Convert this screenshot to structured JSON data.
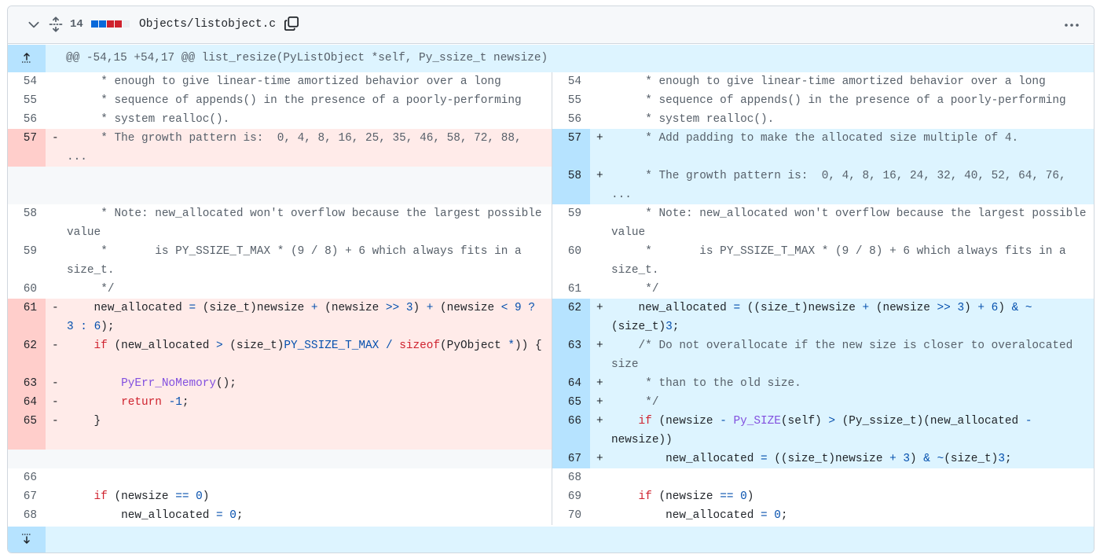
{
  "file": {
    "changes": "14",
    "diffstat": [
      "#0969da",
      "#0969da",
      "#cf222e",
      "#cf222e",
      "#eaeef2"
    ],
    "name": "Objects/listobject.c"
  },
  "hunk": {
    "header": "@@ -54,15 +54,17 @@ list_resize(PyListObject *self, Py_ssize_t newsize)"
  },
  "colors": {
    "deletion": "#ffebe9",
    "addition": "#ddf4ff",
    "keyword": "#cf222e",
    "function": "#8250df"
  },
  "icons": [
    "chevron-down-icon",
    "unfold-icon",
    "copy-icon",
    "kebab-horizontal-icon",
    "expand-up-icon",
    "expand-down-icon"
  ],
  "rows": [
    {
      "h": 24,
      "l": {
        "n": "54",
        "t": "ctx",
        "html": "<span class=\"cm\">     * enough to give linear-time amortized behavior over a long</span>"
      },
      "r": {
        "n": "54",
        "t": "ctx",
        "html": "<span class=\"cm\">     * enough to give linear-time amortized behavior over a long</span>"
      }
    },
    {
      "h": 24,
      "l": {
        "n": "55",
        "t": "ctx",
        "html": "<span class=\"cm\">     * sequence of appends() in the presence of a poorly-performing</span>"
      },
      "r": {
        "n": "55",
        "t": "ctx",
        "html": "<span class=\"cm\">     * sequence of appends() in the presence of a poorly-performing</span>"
      }
    },
    {
      "h": 24,
      "l": {
        "n": "56",
        "t": "ctx",
        "html": "<span class=\"cm\">     * system realloc().</span>"
      },
      "r": {
        "n": "56",
        "t": "ctx",
        "html": "<span class=\"cm\">     * system realloc().</span>"
      }
    },
    {
      "h": 48,
      "l": {
        "n": "57",
        "t": "del",
        "html": "<span class=\"cm\">     * The growth pattern is:  0, 4, 8, 16, 25, 35, 46, 58, 72, 88, ...</span>"
      },
      "r": {
        "n": "57",
        "t": "add",
        "html": "<span class=\"cm\">     * Add padding to make the allocated size multiple of 4.</span>"
      }
    },
    {
      "h": 48,
      "l": {
        "n": "",
        "t": "empty",
        "html": ""
      },
      "r": {
        "n": "58",
        "t": "add",
        "html": "<span class=\"cm\">     * The growth pattern is:  0, 4, 8, 16, 24, 32, 40, 52, 64, 76, ...</span>"
      }
    },
    {
      "h": 48,
      "l": {
        "n": "58",
        "t": "ctx",
        "html": "<span class=\"cm\">     * Note: new_allocated won't overflow because the largest possible value</span>"
      },
      "r": {
        "n": "59",
        "t": "ctx",
        "html": "<span class=\"cm\">     * Note: new_allocated won't overflow because the largest possible value</span>"
      }
    },
    {
      "h": 48,
      "l": {
        "n": "59",
        "t": "ctx",
        "html": "<span class=\"cm\">     *       is PY_SSIZE_T_MAX * (9 / 8) + 6 which always fits in a size_t.</span>"
      },
      "r": {
        "n": "60",
        "t": "ctx",
        "html": "<span class=\"cm\">     *       is PY_SSIZE_T_MAX * (9 / 8) + 6 which always fits in a size_t.</span>"
      }
    },
    {
      "h": 24,
      "l": {
        "n": "60",
        "t": "ctx",
        "html": "<span class=\"cm\">     */</span>"
      },
      "r": {
        "n": "61",
        "t": "ctx",
        "html": "<span class=\"cm\">     */</span>"
      }
    },
    {
      "h": 48,
      "l": {
        "n": "61",
        "t": "del",
        "html": "    new_allocated <span class=\"op\">=</span> (size_t)newsize <span class=\"op\">+</span> (newsize <span class=\"op\">&gt;&gt;</span> <span class=\"num\">3</span>) <span class=\"op\">+</span> (newsize <span class=\"op\">&lt;</span> <span class=\"num\">9</span> <span class=\"op\">?</span> <span class=\"num\">3</span> <span class=\"op\">:</span> <span class=\"num\">6</span>);"
      },
      "r": {
        "n": "62",
        "t": "add",
        "html": "    new_allocated <span class=\"op\">=</span> ((size_t)newsize <span class=\"op\">+</span> (newsize <span class=\"op\">&gt;&gt;</span> <span class=\"num\">3</span>) <span class=\"op\">+</span> <span class=\"num\">6</span>) <span class=\"op\">&amp;</span> <span class=\"op\">~</span>(size_t)<span class=\"num\">3</span>;"
      }
    },
    {
      "h": 48,
      "l": {
        "n": "62",
        "t": "del",
        "html": "    <span class=\"kw\">if</span> (new_allocated <span class=\"op\">&gt;</span> (size_t)<span class=\"ct\">PY_SSIZE_T_MAX</span> <span class=\"op\">/</span> <span class=\"kw\">sizeof</span>(PyObject <span class=\"op\">*</span>)) {"
      },
      "r": {
        "n": "63",
        "t": "add",
        "html": "<span class=\"cm\">    /* Do not overallocate if the new size is closer to overalocated size</span>"
      }
    },
    {
      "h": 24,
      "l": {
        "n": "63",
        "t": "del",
        "html": "        <span class=\"fn\">PyErr_NoMemory</span>();"
      },
      "r": {
        "n": "64",
        "t": "add",
        "html": "<span class=\"cm\">     * than to the old size.</span>"
      }
    },
    {
      "h": 24,
      "l": {
        "n": "64",
        "t": "del",
        "html": "        <span class=\"kw\">return</span> <span class=\"op\">-</span><span class=\"num\">1</span>;"
      },
      "r": {
        "n": "65",
        "t": "add",
        "html": "<span class=\"cm\">     */</span>"
      }
    },
    {
      "h": 48,
      "l": {
        "n": "65",
        "t": "del",
        "html": "    }"
      },
      "r": {
        "n": "66",
        "t": "add",
        "html": "    <span class=\"kw\">if</span> (newsize <span class=\"op\">-</span> <span class=\"fn\">Py_SIZE</span>(self) <span class=\"op\">&gt;</span> (Py_ssize_t)(new_allocated <span class=\"op\">-</span> newsize))"
      }
    },
    {
      "h": 24,
      "l": {
        "n": "",
        "t": "empty",
        "html": ""
      },
      "r": {
        "n": "67",
        "t": "add",
        "html": "        new_allocated <span class=\"op\">=</span> ((size_t)newsize <span class=\"op\">+</span> <span class=\"num\">3</span>) <span class=\"op\">&amp;</span> <span class=\"op\">~</span>(size_t)<span class=\"num\">3</span>;"
      }
    },
    {
      "h": 24,
      "l": {
        "n": "66",
        "t": "ctx",
        "html": ""
      },
      "r": {
        "n": "68",
        "t": "ctx",
        "html": ""
      }
    },
    {
      "h": 24,
      "l": {
        "n": "67",
        "t": "ctx",
        "html": "    <span class=\"kw\">if</span> (newsize <span class=\"op\">==</span> <span class=\"num\">0</span>)"
      },
      "r": {
        "n": "69",
        "t": "ctx",
        "html": "    <span class=\"kw\">if</span> (newsize <span class=\"op\">==</span> <span class=\"num\">0</span>)"
      }
    },
    {
      "h": 24,
      "l": {
        "n": "68",
        "t": "ctx",
        "html": "        new_allocated <span class=\"op\">=</span> <span class=\"num\">0</span>;"
      },
      "r": {
        "n": "70",
        "t": "ctx",
        "html": "        new_allocated <span class=\"op\">=</span> <span class=\"num\">0</span>;"
      }
    }
  ]
}
